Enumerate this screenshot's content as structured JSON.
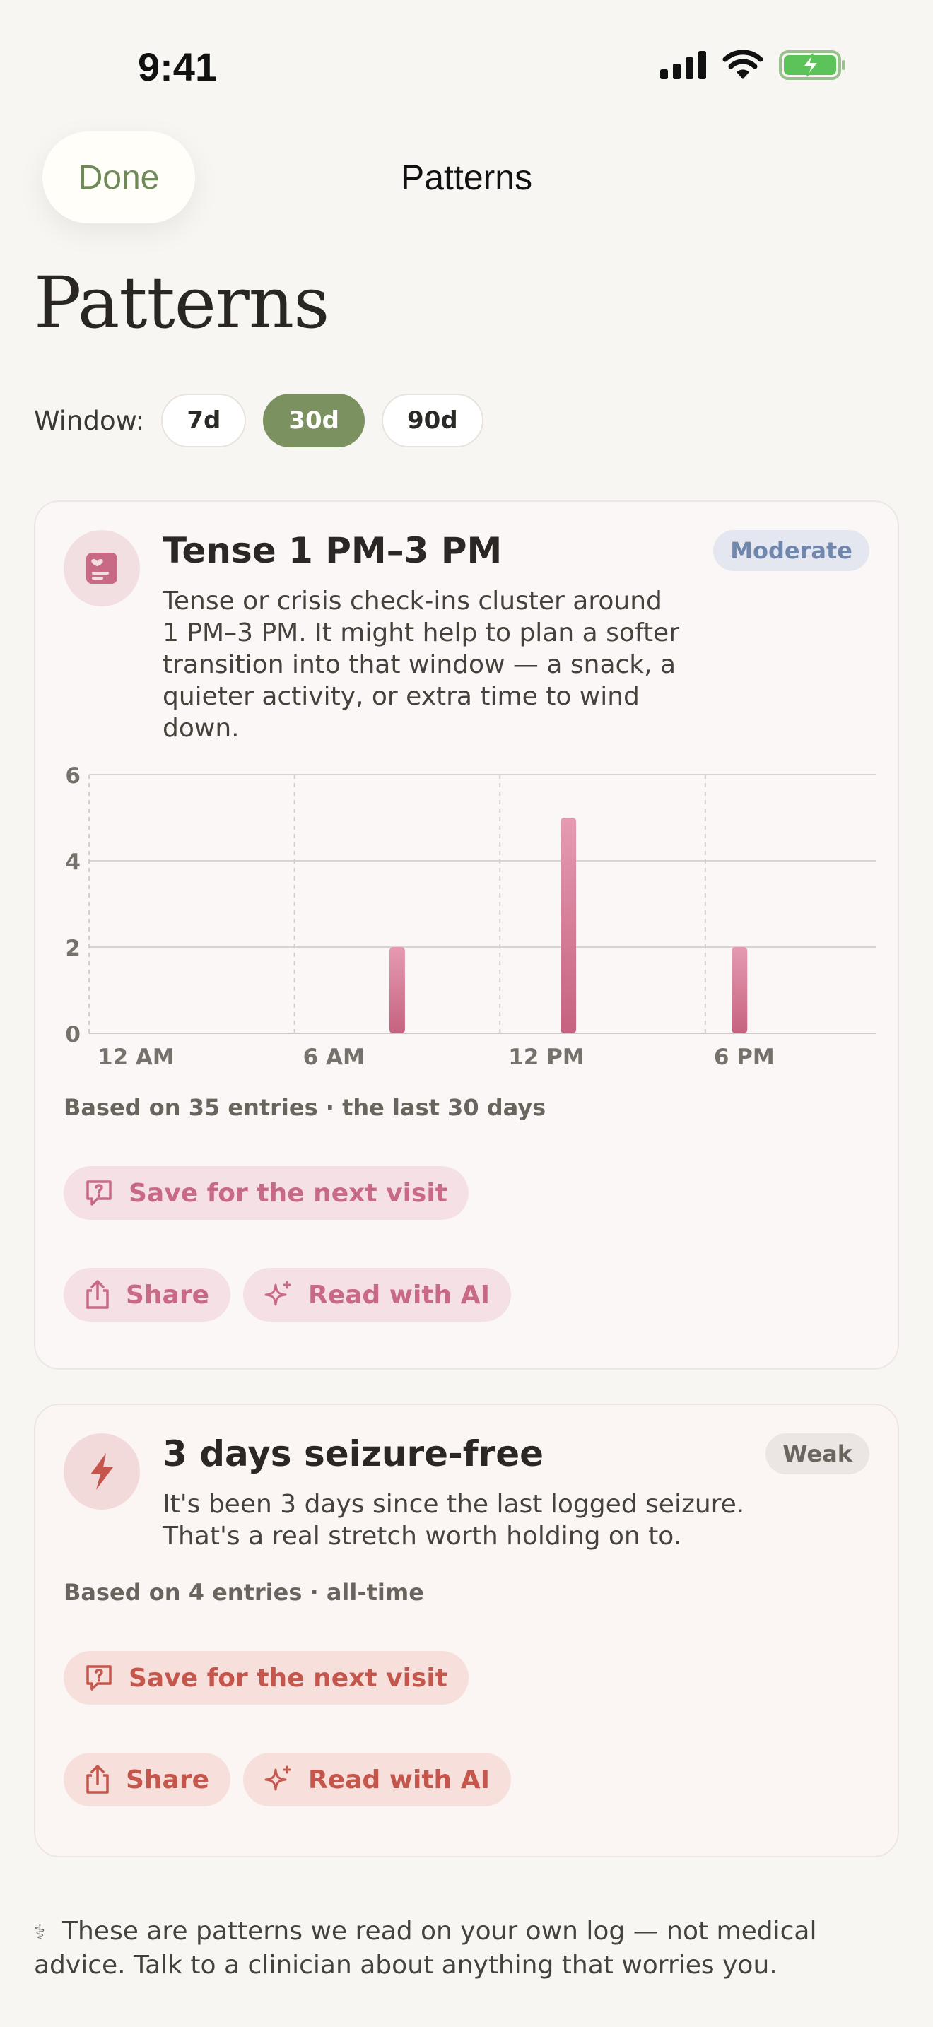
{
  "status_bar": {
    "time": "9:41"
  },
  "nav": {
    "done_label": "Done",
    "title": "Patterns"
  },
  "page": {
    "title": "Patterns"
  },
  "window": {
    "label": "Window:",
    "options": [
      "7d",
      "30d",
      "90d"
    ],
    "selected": "30d"
  },
  "cards": [
    {
      "icon": "journal-heart-icon",
      "title": "Tense 1 PM–3 PM",
      "badge": "Moderate",
      "body": "Tense or crisis check-ins cluster around 1 PM–3 PM. It might help to plan a softer transition into that window — a snack, a quieter activity, or extra time to wind down.",
      "based_on": "Based on 35 entries · the last 30 days",
      "save_label": "Save for the next visit",
      "share_label": "Share",
      "ai_label": "Read with AI",
      "colors": {
        "accent": "#c86a86",
        "bar_top": "#e59bb2",
        "bar_bottom": "#c6627f"
      }
    },
    {
      "icon": "lightning-bolt-icon",
      "title": "3 days seizure-free",
      "badge": "Weak",
      "body": "It's been 3 days since the last logged seizure. That's a real stretch worth holding on to.",
      "based_on": "Based on 4 entries · all-time",
      "save_label": "Save for the next visit",
      "share_label": "Share",
      "ai_label": "Read with AI",
      "colors": {
        "accent": "#c4564c"
      }
    }
  ],
  "chart_data": {
    "type": "bar",
    "x_unit": "hour of day",
    "xlim": [
      0,
      23
    ],
    "x_ticks": [
      0,
      6,
      12,
      18
    ],
    "x_tick_labels": [
      "12 AM",
      "6 AM",
      "12 PM",
      "6 PM"
    ],
    "ylim": [
      0,
      6
    ],
    "y_ticks": [
      0,
      2,
      4,
      6
    ],
    "x": [
      9,
      14,
      19
    ],
    "values": [
      2,
      5,
      2
    ],
    "grid": true,
    "title": "",
    "xlabel": "",
    "ylabel": ""
  },
  "footer": {
    "text": "These are patterns we read on your own log — not medical advice. Talk to a clinician about anything that worries you."
  }
}
